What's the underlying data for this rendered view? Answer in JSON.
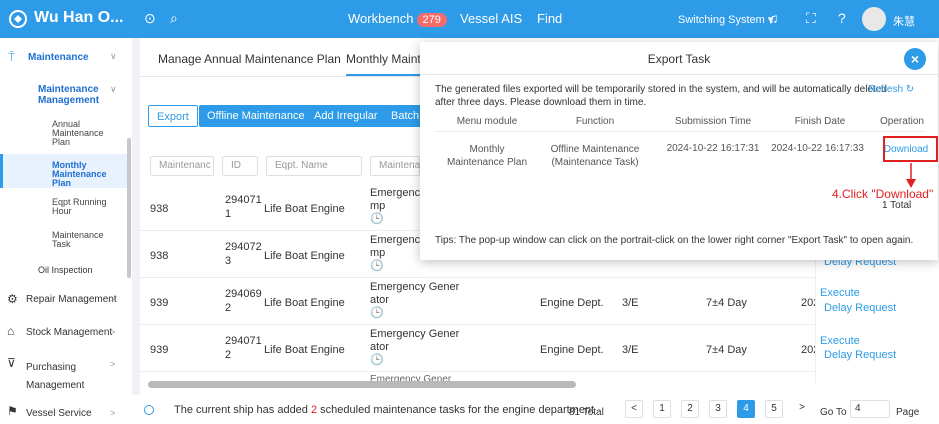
{
  "topbar": {
    "app_name": "Wu Han O...",
    "workbench": "Workbench",
    "workbench_count": "279",
    "vessel_ais": "Vessel AIS",
    "find": "Find",
    "switching": "Switching System ▾",
    "user": "朱慧"
  },
  "sidebar": {
    "maintenance": "Maintenance",
    "maint_mgmt_1": "Maintenance",
    "maint_mgmt_2": "Management",
    "annual_1": "Annual",
    "annual_2": "Maintenance",
    "annual_3": "Plan",
    "monthly_1": "Monthly",
    "monthly_2": "Maintenance",
    "monthly_3": "Plan",
    "eqpt_1": "Eqpt Running",
    "eqpt_2": "Hour",
    "mtask_1": "Maintenance",
    "mtask_2": "Task",
    "oil": "Oil Inspection",
    "repair": "Repair Management",
    "stock": "Stock Management",
    "purch_1": "Purchasing",
    "purch_2": "Management",
    "vessel": "Vessel Service"
  },
  "tabs": {
    "annual": "Manage Annual Maintenance Plan",
    "monthly": "Monthly Mainte"
  },
  "toolbar": {
    "export": "Export",
    "offline": "Offline Maintenance",
    "irregular": "Add Irregular",
    "batch": "Batch A"
  },
  "filters": {
    "maint": "Maintenanc",
    "id": "ID",
    "eqpt": "Eqpt. Name",
    "maint2": "Maintenanc"
  },
  "rows": [
    {
      "no": "938",
      "id1": "294071",
      "id2": "1",
      "name": "Life Boat Engine",
      "t1": "Emergency I",
      "t2": "mp"
    },
    {
      "no": "938",
      "id1": "294072",
      "id2": "3",
      "name": "Life Boat Engine",
      "t1": "Emergency I",
      "t2": "mp"
    },
    {
      "no": "939",
      "id1": "294069",
      "id2": "2",
      "name": "Life Boat Engine",
      "t1": "Emergency Gener",
      "t2": "ator",
      "dept": "Engine Dept.",
      "rank": "3/E",
      "cycle": "7±4 Day",
      "date": "202",
      "exec": "Execute",
      "req": "Delay Request"
    },
    {
      "no": "939",
      "id1": "294071",
      "id2": "2",
      "name": "Life Boat Engine",
      "t1": "Emergency Gener",
      "t2": "ator",
      "dept": "Engine Dept.",
      "rank": "3/E",
      "cycle": "7±4 Day",
      "date": "202",
      "exec": "Execute",
      "req": "Delay Request"
    }
  ],
  "partial_row": "Emergency Gener",
  "delay_partial": "Delay Request",
  "footer": {
    "notice_pre": "The current ship has added ",
    "notice_count": "2",
    "notice_post": " scheduled maintenance tasks for the engine department",
    "total": "81 Total",
    "pages": [
      "1",
      "2",
      "3",
      "4",
      "5"
    ],
    "goto": "Go To",
    "goto_val": "4",
    "page": "Page"
  },
  "modal": {
    "title": "Export Task",
    "info_1": "The generated files exported will be temporarily stored in the system, and will be automatically deleted",
    "info_2": "after three days. Please download them in time.",
    "refresh": "Refresh",
    "headers": [
      "Menu module",
      "Function",
      "Submission Time",
      "Finish Date",
      "Operation"
    ],
    "r_module_1": "Monthly",
    "r_module_2": "Maintenance Plan",
    "r_func_1": "Offline Maintenance",
    "r_func_2": "(Maintenance Task)",
    "r_sub": "2024-10-22 16:17:31",
    "r_fin": "2024-10-22 16:17:33",
    "r_op": "Download",
    "total": "1 Total",
    "tips": "Tips: The pop-up window can click on the portrait-click on the lower right corner \"Export Task\" to open again."
  },
  "annotation": "4.Click \"Download\""
}
